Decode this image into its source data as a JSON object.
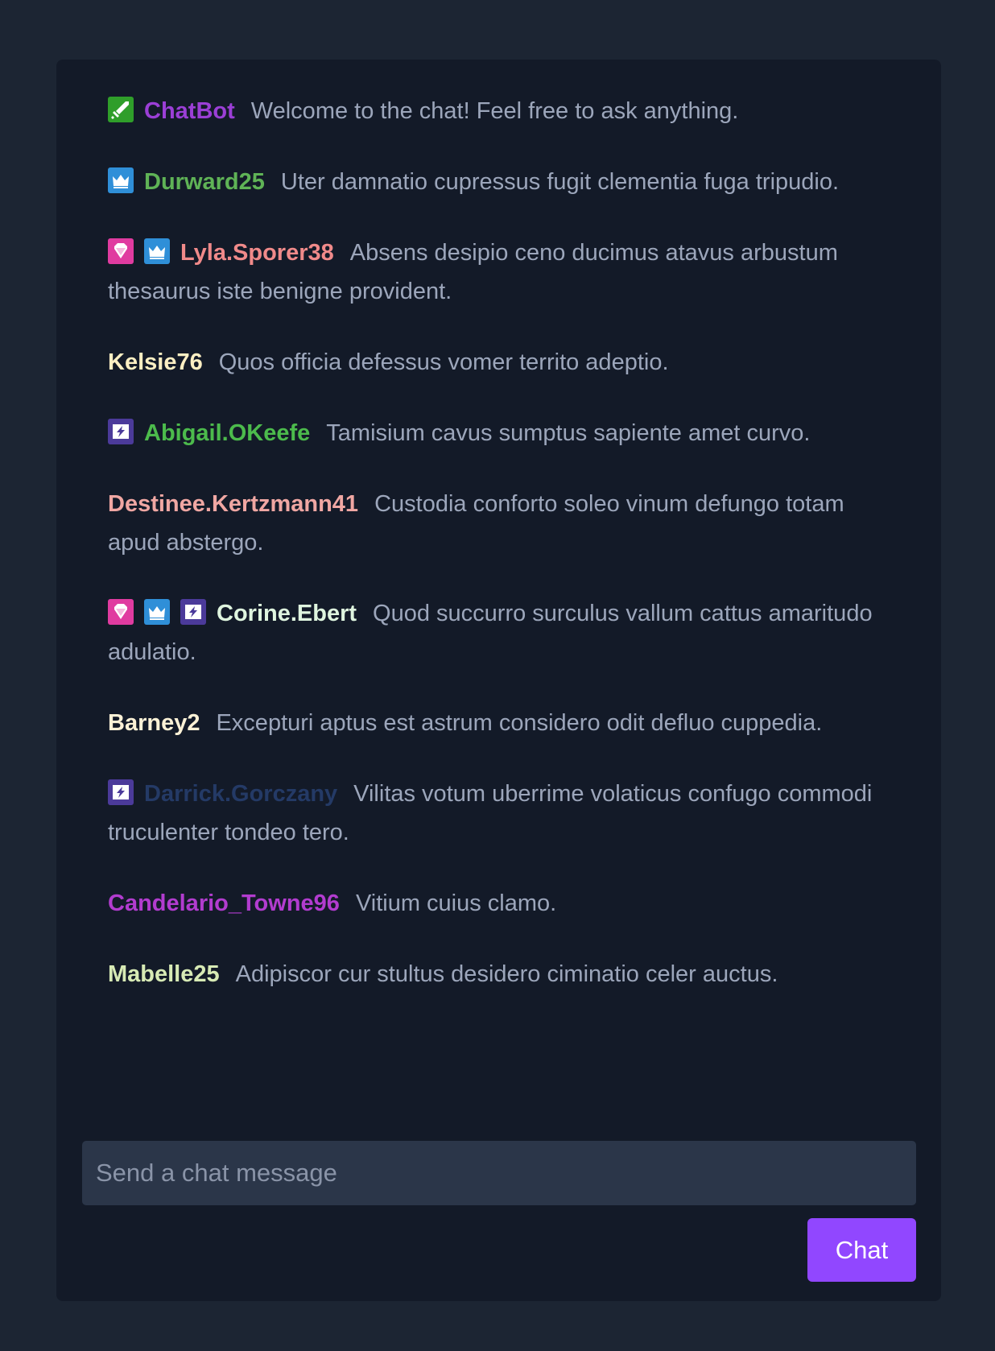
{
  "chat": {
    "input_placeholder": "Send a chat message",
    "send_label": "Chat",
    "messages": [
      {
        "user": "ChatBot",
        "color": "#9b3fd6",
        "badges": [
          "sword"
        ],
        "text": "Welcome to the chat! Feel free to ask anything."
      },
      {
        "user": "Durward25",
        "color": "#5fb356",
        "badges": [
          "crown"
        ],
        "text": "Uter damnatio cupressus fugit clementia fuga tripudio."
      },
      {
        "user": "Lyla.Sporer38",
        "color": "#f08a8a",
        "badges": [
          "gem",
          "crown"
        ],
        "text": "Absens desipio ceno ducimus atavus arbustum thesaurus iste benigne provident."
      },
      {
        "user": "Kelsie76",
        "color": "#fcefc3",
        "badges": [],
        "text": "Quos officia defessus vomer territo adeptio."
      },
      {
        "user": "Abigail.OKeefe",
        "color": "#4cbb4c",
        "badges": [
          "prime"
        ],
        "text": "Tamisium cavus sumptus sapiente amet curvo."
      },
      {
        "user": "Destinee.Kertzmann41",
        "color": "#f0a7a3",
        "badges": [],
        "text": "Custodia conforto soleo vinum defungo totam apud abstergo."
      },
      {
        "user": "Corine.Ebert",
        "color": "#dff5df",
        "badges": [
          "gem",
          "crown",
          "prime"
        ],
        "text": "Quod succurro surculus vallum cattus amaritudo adulatio."
      },
      {
        "user": "Barney2",
        "color": "#fbf1d6",
        "badges": [],
        "text": "Excepturi aptus est astrum considero odit defluo cuppedia."
      },
      {
        "user": "Darrick.Gorczany",
        "color": "#243a66",
        "badges": [
          "prime"
        ],
        "text": "Vilitas votum uberrime volaticus confugo commodi truculenter tondeo tero."
      },
      {
        "user": "Candelario_Towne96",
        "color": "#b23ccf",
        "badges": [],
        "text": "Vitium cuius clamo."
      },
      {
        "user": "Mabelle25",
        "color": "#d7eab5",
        "badges": [],
        "text": "Adipiscor cur stultus desidero ciminatio celer auctus."
      }
    ]
  },
  "badge_icons": {
    "sword": "sword-icon",
    "crown": "crown-icon",
    "gem": "gem-icon",
    "prime": "prime-icon"
  }
}
